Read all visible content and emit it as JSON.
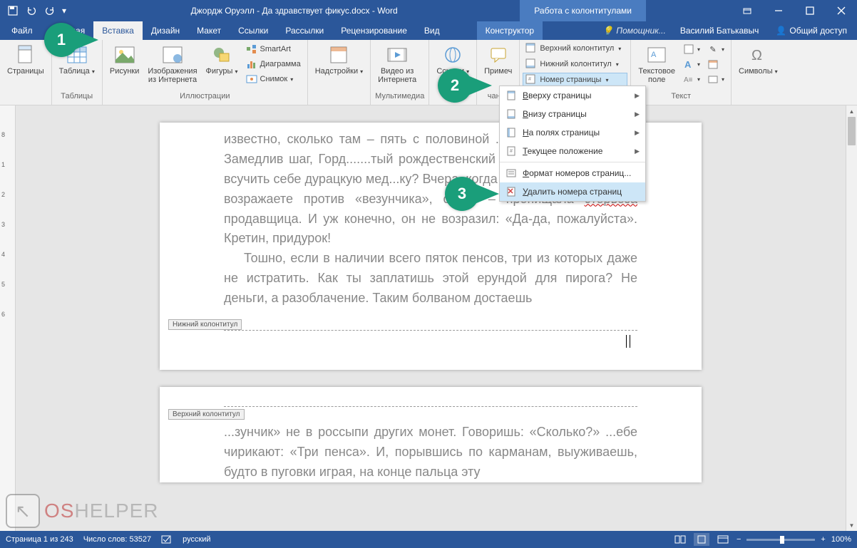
{
  "titlebar": {
    "title": "Джордж Оруэлл - Да здравствует фикус.docx - Word",
    "context_label": "Работа с колонтитулами"
  },
  "tabs": {
    "file": "Файл",
    "list": [
      "Главная",
      "Вставка",
      "Дизайн",
      "Макет",
      "Ссылки",
      "Рассылки",
      "Рецензирование",
      "Вид"
    ],
    "active": "Вставка",
    "context": "Конструктор",
    "helper": "Помощник...",
    "username": "Василий Батькавыч",
    "share": "Общий доступ"
  },
  "ribbon": {
    "pages": {
      "btn": "Страницы",
      "label": ""
    },
    "tables": {
      "btn": "Таблица",
      "label": "Таблицы"
    },
    "illustrations": {
      "pictures": "Рисунки",
      "online_pictures": "Изображения\nиз Интернета",
      "shapes": "Фигуры",
      "smartart": "SmartArt",
      "chart": "Диаграмма",
      "screenshot": "Снимок",
      "label": "Иллюстрации"
    },
    "addins": {
      "btn": "Надстройки",
      "label": ""
    },
    "media": {
      "btn": "Видео из\nИнтернета",
      "label": "Мультимедиа"
    },
    "links": {
      "btn": "Ссылки",
      "label": ""
    },
    "comments": {
      "btn": "Примеч",
      "label": "чания"
    },
    "headerfooter": {
      "header": "Верхний колонтитул",
      "footer": "Нижний колонтитул",
      "pagenum": "Номер страницы"
    },
    "text": {
      "btn": "Текстовое\nполе",
      "label": "Текст"
    },
    "symbols": {
      "btn": "Символы",
      "label": ""
    }
  },
  "dropdown": {
    "items": [
      {
        "label": "Вверху страницы",
        "arrow": true,
        "u": "В"
      },
      {
        "label": "Внизу страницы",
        "arrow": true,
        "u": "В"
      },
      {
        "label": "На полях страницы",
        "arrow": true,
        "u": "Н"
      },
      {
        "label": "Текущее положение",
        "arrow": true,
        "u": "Т"
      },
      {
        "label": "Формат номеров страниц...",
        "arrow": false,
        "u": "Ф"
      },
      {
        "label": "Удалить номера страниц",
        "arrow": false,
        "u": "У",
        "highlight": true
      }
    ]
  },
  "document": {
    "para1": "известно, сколько там – пять с половиной ... ....нни и «везунчик». Замедлив шаг, Горд.......тый рождественский трехпенсови...........лил всучить себе дурацкую мед...ку? Вчера, когда покупал сигареты. «Не возражаете против «везунчика», сэр?» – пропищала ",
    "err": "стервоза",
    "para1b": " продавщица. И уж конечно, он не возразил: «Да-да, пожалуйста». Кретин, придурок!",
    "para2": "Тошно, если в наличии всего пяток пенсов, три из которых даже не истратить. Как ты заплатишь этой ерундой для пирога? Не деньги, а разоблачение. Таким болваном достаешь",
    "footer_label": "Нижний колонтитул",
    "header_label": "Верхний колонтитул",
    "page2": "...зунчик» не в россыпи других монет. Говоришь: «Сколько?» ...ебе чирикают: «Три пенса». И, порывшись по карманам, выуживаешь, будто в пуговки играя, на конце пальца эту"
  },
  "statusbar": {
    "page": "Страница 1 из 243",
    "words": "Число слов: 53527",
    "lang": "русский",
    "zoom": "100%"
  },
  "markers": {
    "m1": "1",
    "m2": "2",
    "m3": "3"
  },
  "watermark": {
    "os": "OS",
    "helper": "HELPER"
  }
}
